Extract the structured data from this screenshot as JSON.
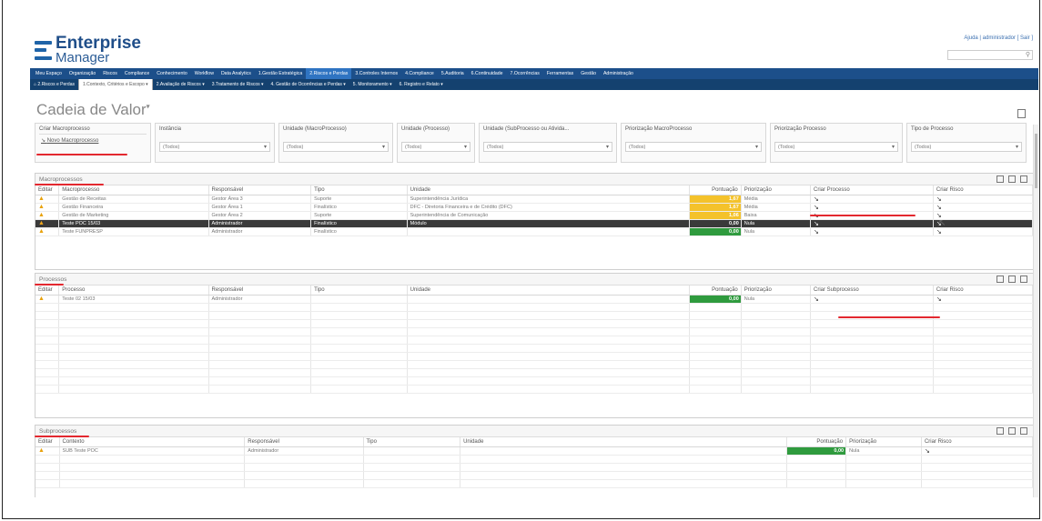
{
  "app": {
    "name_line1": "Enterprise",
    "name_line2": "Manager"
  },
  "toplinks": "Ajuda  |  administrador  [ Sair ]",
  "nav_main": [
    "Meu Espaço",
    "Organização",
    "Riscos",
    "Compliance",
    "Conhecimento",
    "Workflow",
    "Data Analytics",
    "1.Gestão Estratégica",
    "2.Riscos e Perdas",
    "3.Controles Internos",
    "4.Compliance",
    "5.Auditoria",
    "6.Continuidade",
    "7.Ocorrências",
    "Ferramentas",
    "Gestão",
    "Administração"
  ],
  "nav_main_active": 8,
  "nav_sub": [
    "⌂  2.Riscos e Perdas",
    "1.Contexto, Critérios e Escopo  ▾",
    "2.Avaliação de Riscos  ▾",
    "3.Tratamento de Riscos  ▾",
    "4. Gestão de Ocorrências e Perdas  ▾",
    "5. Monitoramento  ▾",
    "6. Registro e Relato  ▾"
  ],
  "page_title": "Cadeia de Valor",
  "filters": {
    "create_label": "Criar Macroprocesso",
    "create_link": "Novo Macroprocesso",
    "items": [
      {
        "label": "Instância",
        "value": "(Todos)"
      },
      {
        "label": "Unidade (MacroProcesso)",
        "value": "(Todos)"
      },
      {
        "label": "Unidade (Processo)",
        "value": "(Todos)"
      },
      {
        "label": "Unidade (SubProcesso ou Ativida...",
        "value": "(Todos)"
      },
      {
        "label": "Priorização MacroProcesso",
        "value": "(Todos)"
      },
      {
        "label": "Priorização Processo",
        "value": "(Todos)"
      },
      {
        "label": "Tipo de Processo",
        "value": "(Todos)"
      }
    ]
  },
  "macro": {
    "title": "Macroprocessos",
    "headers": [
      "Editar",
      "Macroprocesso",
      "Responsável",
      "Tipo",
      "Unidade",
      "Pontuação",
      "Priorização",
      "Criar Processo",
      "Criar Risco"
    ],
    "rows": [
      {
        "name": "Gestão de Receitas",
        "resp": "Gestor Área 3",
        "tipo": "Suporte",
        "unidade": "Superintendência Jurídica",
        "score": "1,67",
        "prior": "Média",
        "sc": "y",
        "sel": false
      },
      {
        "name": "Gestão Financeira",
        "resp": "Gestor Área 1",
        "tipo": "Finalístico",
        "unidade": "DFC - Diretoria Financeira e de Crédito (DFC)",
        "score": "1,67",
        "prior": "Média",
        "sc": "y",
        "sel": false
      },
      {
        "name": "Gestão de Marketing",
        "resp": "Gestor Área 2",
        "tipo": "Suporte",
        "unidade": "Superintendência de Comunicação",
        "score": "1,06",
        "prior": "Baixa",
        "sc": "y",
        "sel": false
      },
      {
        "name": "Teste POC 15/03",
        "resp": "Administrador",
        "tipo": "Finalístico",
        "unidade": "Módulo",
        "score": "0,00",
        "prior": "Nula",
        "sc": "d",
        "sel": true
      },
      {
        "name": "Teste FUNPRESP",
        "resp": "Administrador",
        "tipo": "Finalístico",
        "unidade": "",
        "score": "0,00",
        "prior": "Nula",
        "sc": "g",
        "sel": false
      }
    ]
  },
  "proc": {
    "title": "Processos",
    "headers": [
      "Editar",
      "Processo",
      "Responsável",
      "Tipo",
      "Unidade",
      "Pontuação",
      "Priorização",
      "Criar Subprocesso",
      "Criar Risco"
    ],
    "rows": [
      {
        "name": "Teste 02 15/03",
        "resp": "Administrador",
        "tipo": "",
        "unidade": "",
        "score": "0,00",
        "prior": "Nula",
        "sc": "g",
        "sel": false
      }
    ]
  },
  "sub": {
    "title": "Subprocessos",
    "headers": [
      "Editar",
      "Contexto",
      "Responsável",
      "Tipo",
      "Unidade",
      "Pontuação",
      "Priorização",
      "Criar Risco"
    ],
    "rows": [
      {
        "name": "SUB Teste POC",
        "resp": "Administrador",
        "tipo": "",
        "unidade": "",
        "score": "0,00",
        "prior": "Nula",
        "sc": "g",
        "sel": false
      }
    ]
  },
  "icons": {
    "edit": "pencil-icon",
    "create": "create-arrow-icon",
    "export": "export-icon",
    "filter": "filter-icon",
    "columns": "columns-icon"
  },
  "colors": {
    "nav": "#1c4f8a",
    "score_yellow": "#f4c22b",
    "score_green": "#2f9b3e",
    "selected_row": "#3a3a3a",
    "annotation_red": "#e3282f"
  }
}
